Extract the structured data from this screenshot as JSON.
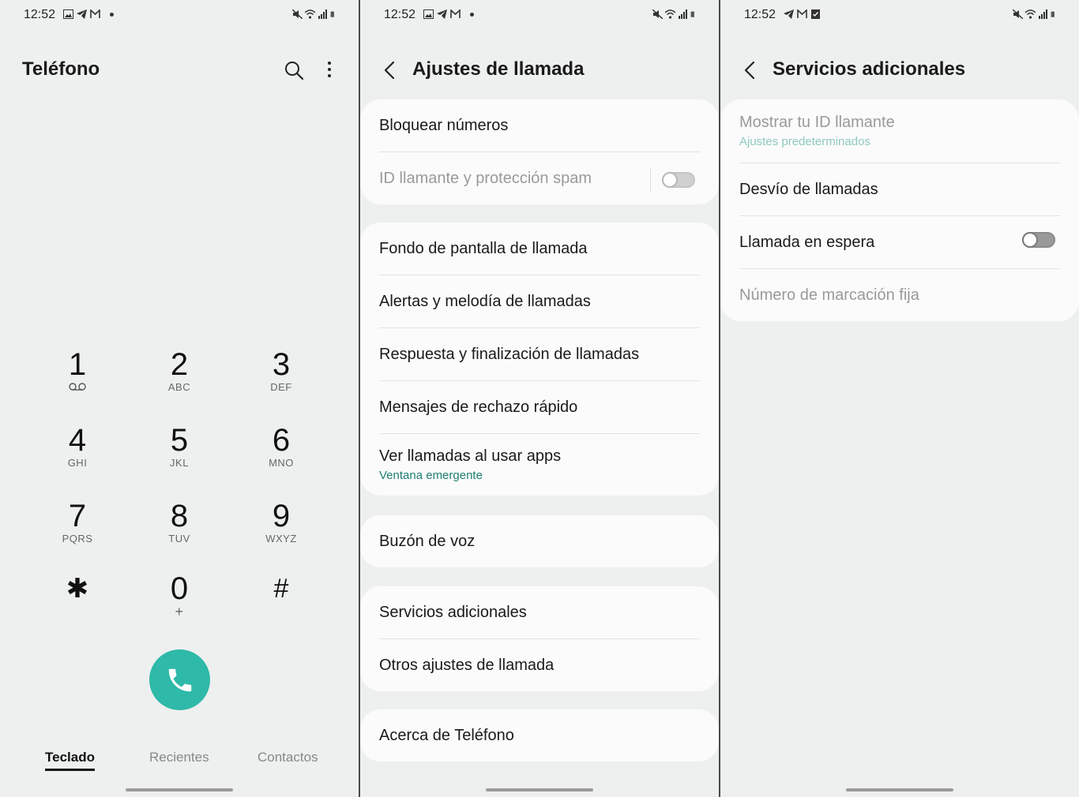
{
  "dialer": {
    "status_time": "12:52",
    "title": "Teléfono",
    "search_icon": "search-icon",
    "more_icon": "more-vert-icon",
    "keys": [
      {
        "num": "1",
        "sub": "voicemail"
      },
      {
        "num": "2",
        "sub": "ABC"
      },
      {
        "num": "3",
        "sub": "DEF"
      },
      {
        "num": "4",
        "sub": "GHI"
      },
      {
        "num": "5",
        "sub": "JKL"
      },
      {
        "num": "6",
        "sub": "MNO"
      },
      {
        "num": "7",
        "sub": "PQRS"
      },
      {
        "num": "8",
        "sub": "TUV"
      },
      {
        "num": "9",
        "sub": "WXYZ"
      },
      {
        "num": "✱",
        "sub": ""
      },
      {
        "num": "0",
        "sub": "+"
      },
      {
        "num": "#",
        "sub": ""
      }
    ],
    "call_color": "#2fb9a8",
    "tabs": {
      "keypad": "Teclado",
      "recents": "Recientes",
      "contacts": "Contactos"
    }
  },
  "call_settings": {
    "status_time": "12:52",
    "title": "Ajustes de llamada",
    "block_numbers": "Bloquear números",
    "caller_id_spam": "ID llamante y protección spam",
    "caller_id_spam_on": false,
    "wallpaper": "Fondo de pantalla de llamada",
    "alerts_ringtone": "Alertas y melodía de llamadas",
    "answer_end": "Respuesta y finalización de llamadas",
    "quick_decline": "Mensajes de rechazo rápido",
    "calls_in_apps": "Ver llamadas al usar apps",
    "calls_in_apps_sub": "Ventana emergente",
    "voicemail": "Buzón de voz",
    "supplementary": "Servicios adicionales",
    "other_settings": "Otros ajustes de llamada",
    "about": "Acerca de Teléfono"
  },
  "supplementary": {
    "status_time": "12:52",
    "title": "Servicios adicionales",
    "show_caller_id": "Mostrar tu ID llamante",
    "show_caller_id_sub": "Ajustes predeterminados",
    "call_forwarding": "Desvío de llamadas",
    "call_waiting": "Llamada en espera",
    "call_waiting_on": false,
    "fixed_dialing": "Número de marcación fija"
  },
  "accent_color": "#1f7f72"
}
